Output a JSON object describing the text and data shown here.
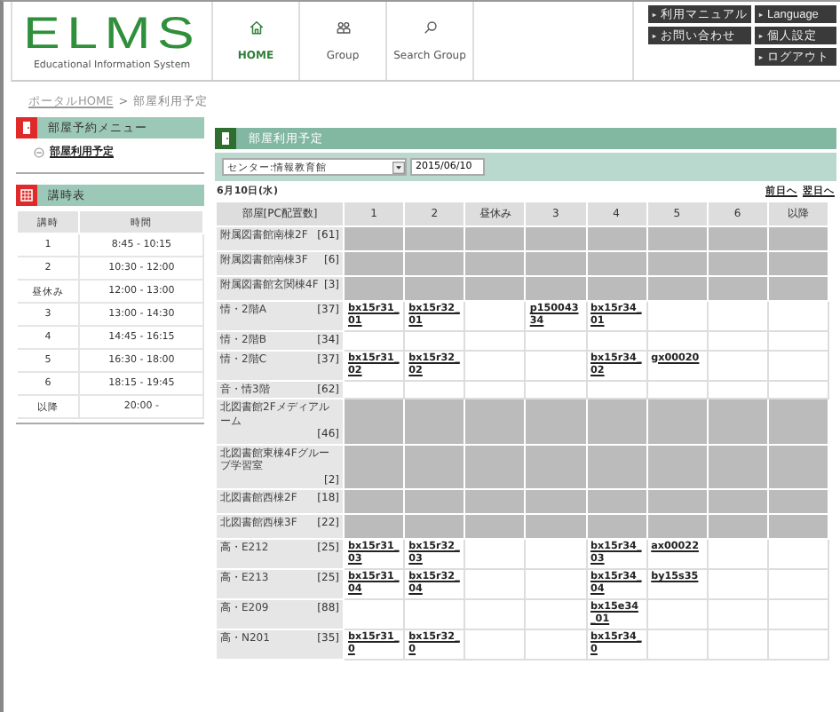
{
  "logo": {
    "title": "ELMS",
    "subtitle": "Educational Information System"
  },
  "nav": [
    {
      "label": "HOME",
      "selected": true
    },
    {
      "label": "Group",
      "selected": false
    },
    {
      "label": "Search Group",
      "selected": false
    }
  ],
  "header_links": [
    "利用マニュアル",
    "Language",
    "お問い合わせ",
    "個人設定",
    "ログアウト"
  ],
  "breadcrumb": {
    "link": "ポータルHOME",
    "separator": ">",
    "current": "部屋利用予定"
  },
  "reservation_menu": {
    "title": "部屋予約メニュー",
    "items": [
      "部屋利用予定"
    ]
  },
  "timetable": {
    "title": "講時表",
    "columns": [
      "講時",
      "時間"
    ],
    "rows": [
      [
        "1",
        "8:45 - 10:15"
      ],
      [
        "2",
        "10:30 - 12:00"
      ],
      [
        "昼休み",
        "12:00 - 13:00"
      ],
      [
        "3",
        "13:00 - 14:30"
      ],
      [
        "4",
        "14:45 - 16:15"
      ],
      [
        "5",
        "16:30 - 18:00"
      ],
      [
        "6",
        "18:15 - 19:45"
      ],
      [
        "以降",
        "20:00 -"
      ]
    ]
  },
  "schedule": {
    "title": "部屋利用予定",
    "building": "センター:情報教育館",
    "date": "2015/06/10",
    "day": "6月10日(水)",
    "prev": "前日へ",
    "next": "翌日へ",
    "room_header": "部屋[PC配置数]",
    "columns": [
      "1",
      "2",
      "昼休み",
      "3",
      "4",
      "5",
      "6",
      "以降"
    ],
    "rows": [
      {
        "room": "附属図書館南棟2F",
        "capacity": "[61]",
        "available": false,
        "cells": []
      },
      {
        "room": "附属図書館南棟3F",
        "capacity": "[6]",
        "available": false,
        "cells": []
      },
      {
        "room": "附属図書館玄関棟4F",
        "capacity": "[3]",
        "available": false,
        "cells": []
      },
      {
        "room": "情・2階A",
        "capacity": "[37]",
        "available": true,
        "cells": [
          "bx15r31_01",
          "bx15r32_01",
          "",
          "p15004334",
          "bx15r34_01",
          "",
          "",
          ""
        ]
      },
      {
        "room": "情・2階B",
        "capacity": "[34]",
        "available": true,
        "cells": [
          "",
          "",
          "",
          "",
          "",
          "",
          "",
          ""
        ]
      },
      {
        "room": "情・2階C",
        "capacity": "[37]",
        "available": true,
        "cells": [
          "bx15r31_02",
          "bx15r32_02",
          "",
          "",
          "bx15r34_02",
          "gx00020",
          "",
          ""
        ]
      },
      {
        "room": "音・情3階",
        "capacity": "[62]",
        "available": true,
        "cells": [
          "",
          "",
          "",
          "",
          "",
          "",
          "",
          ""
        ]
      },
      {
        "room": "北図書館2Fメディアルーム",
        "capacity": "[46]",
        "available": false,
        "cells": []
      },
      {
        "room": "北図書館東棟4Fグループ学習室",
        "capacity": "[2]",
        "available": false,
        "cells": []
      },
      {
        "room": "北図書館西棟2F",
        "capacity": "[18]",
        "available": false,
        "cells": []
      },
      {
        "room": "北図書館西棟3F",
        "capacity": "[22]",
        "available": false,
        "cells": []
      },
      {
        "room": "高・E212",
        "capacity": "[25]",
        "available": true,
        "cells": [
          "bx15r31_03",
          "bx15r32_03",
          "",
          "",
          "bx15r34_03",
          "ax00022",
          "",
          ""
        ]
      },
      {
        "room": "高・E213",
        "capacity": "[25]",
        "available": true,
        "cells": [
          "bx15r31_04",
          "bx15r32_04",
          "",
          "",
          "bx15r34_04",
          "by15s35",
          "",
          ""
        ]
      },
      {
        "room": "高・E209",
        "capacity": "[88]",
        "available": true,
        "cells": [
          "",
          "",
          "",
          "",
          "bx15e34_01",
          "",
          "",
          ""
        ]
      },
      {
        "room": "高・N201",
        "capacity": "[35]",
        "available": true,
        "cells": [
          "bx15r31_0",
          "bx15r32_0",
          "",
          "",
          "bx15r34_0",
          "",
          "",
          ""
        ]
      }
    ]
  }
}
